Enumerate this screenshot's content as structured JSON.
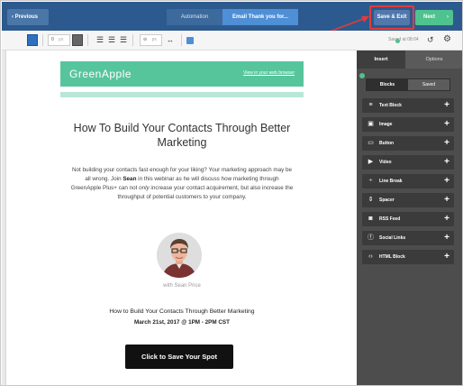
{
  "topbar": {
    "prev_label": "‹ Previous",
    "breadcrumb_automation": "Automation",
    "breadcrumb_email": "Email Thank you for...",
    "save_exit_label": "Save & Exit",
    "next_label": "Next",
    "next_arrow": "›"
  },
  "toolbar": {
    "font_size_value": "0",
    "font_size_unit": "px",
    "width_value": "",
    "width_unit": "px",
    "saved_status": "Saved at 08:04",
    "align_left": "☰",
    "align_center": "☰",
    "align_right": "☰",
    "link_glyph": "⊝",
    "expand_glyph": "↔",
    "history_glyph": "↺",
    "settings_glyph": "⚙"
  },
  "email": {
    "logo": "GreenApple",
    "web_link": "View in your web browser",
    "headline": "How To Build Your Contacts Through Better Marketing",
    "body_part1": "Not building your contacts fast enough for your liking? Your marketing approach may be all wrong. Join ",
    "body_name": "Sean",
    "body_part2": " in this webinar as he will discuss how marketing through GreenApple Plus+ can not ",
    "body_only": "only",
    "body_part3": " increase your contact acquirement, but also increase the throughput of potential customers to your company.",
    "presenter": "with Sean Price",
    "event_title": "How to Build Your Contacts Through Better Marketing",
    "event_date": "March 21st, 2017 @ 1PM - 2PM CST",
    "cta": "Click to Save Your Spot"
  },
  "panel": {
    "tab_insert": "Insert",
    "tab_options": "Options",
    "seg_blocks": "Blocks",
    "seg_saved": "Saved",
    "blocks": [
      {
        "label": "Text Block",
        "icon": "≡",
        "icon_name": "text-block-icon"
      },
      {
        "label": "Image",
        "icon": "▣",
        "icon_name": "image-icon"
      },
      {
        "label": "Button",
        "icon": "▭",
        "icon_name": "button-icon"
      },
      {
        "label": "Video",
        "icon": "▶",
        "icon_name": "video-icon"
      },
      {
        "label": "Line Break",
        "icon": "÷",
        "icon_name": "line-break-icon"
      },
      {
        "label": "Spacer",
        "icon": "⇕",
        "icon_name": "spacer-icon"
      },
      {
        "label": "RSS Feed",
        "icon": "◙",
        "icon_name": "rss-icon"
      },
      {
        "label": "Social Links",
        "icon": "ⓕ",
        "icon_name": "social-links-icon"
      },
      {
        "label": "HTML Block",
        "icon": "‹›",
        "icon_name": "html-block-icon"
      }
    ],
    "plus": "+"
  },
  "colors": {
    "topbar": "#2d5a8e",
    "brand_green": "#57c59c",
    "highlight_red": "#e23b3b",
    "panel_bg": "#4d4d4d"
  }
}
